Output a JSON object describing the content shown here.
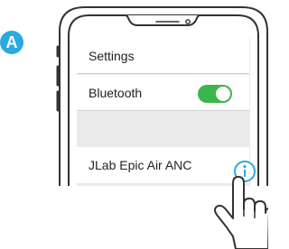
{
  "step_badge": {
    "label": "A",
    "color": "#29aae1"
  },
  "settings": {
    "title": "Settings",
    "bluetooth": {
      "label": "Bluetooth",
      "enabled": true,
      "toggle_color": "#3cb54a"
    },
    "device": {
      "name": "JLab Epic Air ANC",
      "info_icon": "info-icon",
      "info_color": "#29aae1"
    }
  },
  "pointer": {
    "icon": "pointing-hand-icon"
  }
}
